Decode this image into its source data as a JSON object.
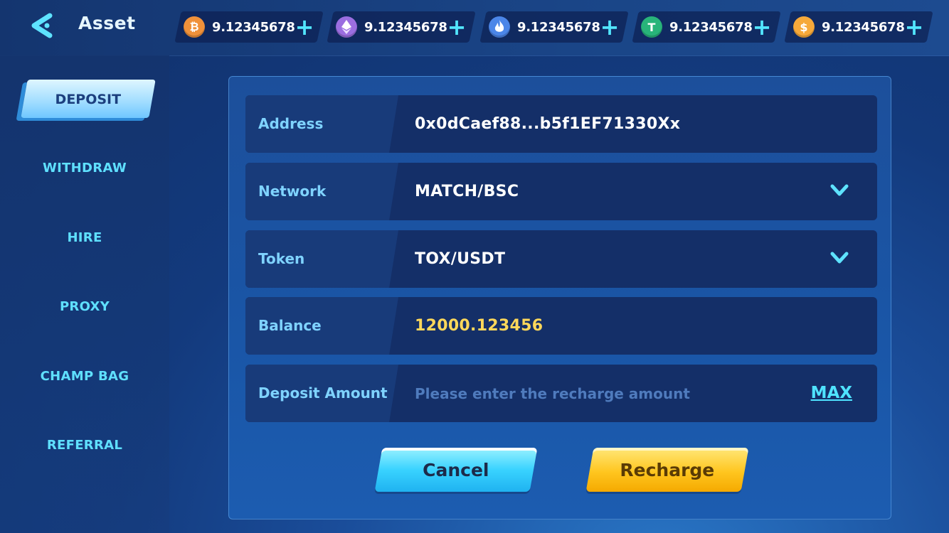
{
  "header": {
    "title": "Asset",
    "back_icon": "back-arrow-icon"
  },
  "balances": [
    {
      "icon": "bitcoin-icon",
      "symbol": "₿",
      "color": "#f0913a",
      "value": "9.12345678"
    },
    {
      "icon": "ethereum-icon",
      "symbol": "◆",
      "color": "#9b6ee0",
      "value": "9.12345678"
    },
    {
      "icon": "flame-icon",
      "symbol": "🔥",
      "color": "#4b86e8",
      "value": "9.12345678"
    },
    {
      "icon": "tether-icon",
      "symbol": "T",
      "color": "#28b47a",
      "value": "9.12345678"
    },
    {
      "icon": "dollar-coin-icon",
      "symbol": "$",
      "color": "#f6a93a",
      "value": "9.12345678"
    }
  ],
  "sidebar": {
    "items": [
      {
        "label": "DEPOSIT",
        "active": true
      },
      {
        "label": "WITHDRAW"
      },
      {
        "label": "HIRE"
      },
      {
        "label": "PROXY"
      },
      {
        "label": "CHAMP BAG"
      },
      {
        "label": "REFERRAL"
      }
    ]
  },
  "form": {
    "address": {
      "label": "Address",
      "value": "0x0dCaef88...b5f1EF71330Xx"
    },
    "network": {
      "label": "Network",
      "value": "MATCH/BSC"
    },
    "token": {
      "label": "Token",
      "value": "TOX/USDT"
    },
    "balance": {
      "label": "Balance",
      "value": "12000.123456"
    },
    "amount": {
      "label": "Deposit Amount",
      "placeholder": "Please enter the recharge amount",
      "max_label": "MAX"
    }
  },
  "buttons": {
    "cancel": "Cancel",
    "recharge": "Recharge"
  },
  "colors": {
    "accent": "#52e6ff",
    "gold": "#ffd85a",
    "panel": "#1a56a7"
  }
}
